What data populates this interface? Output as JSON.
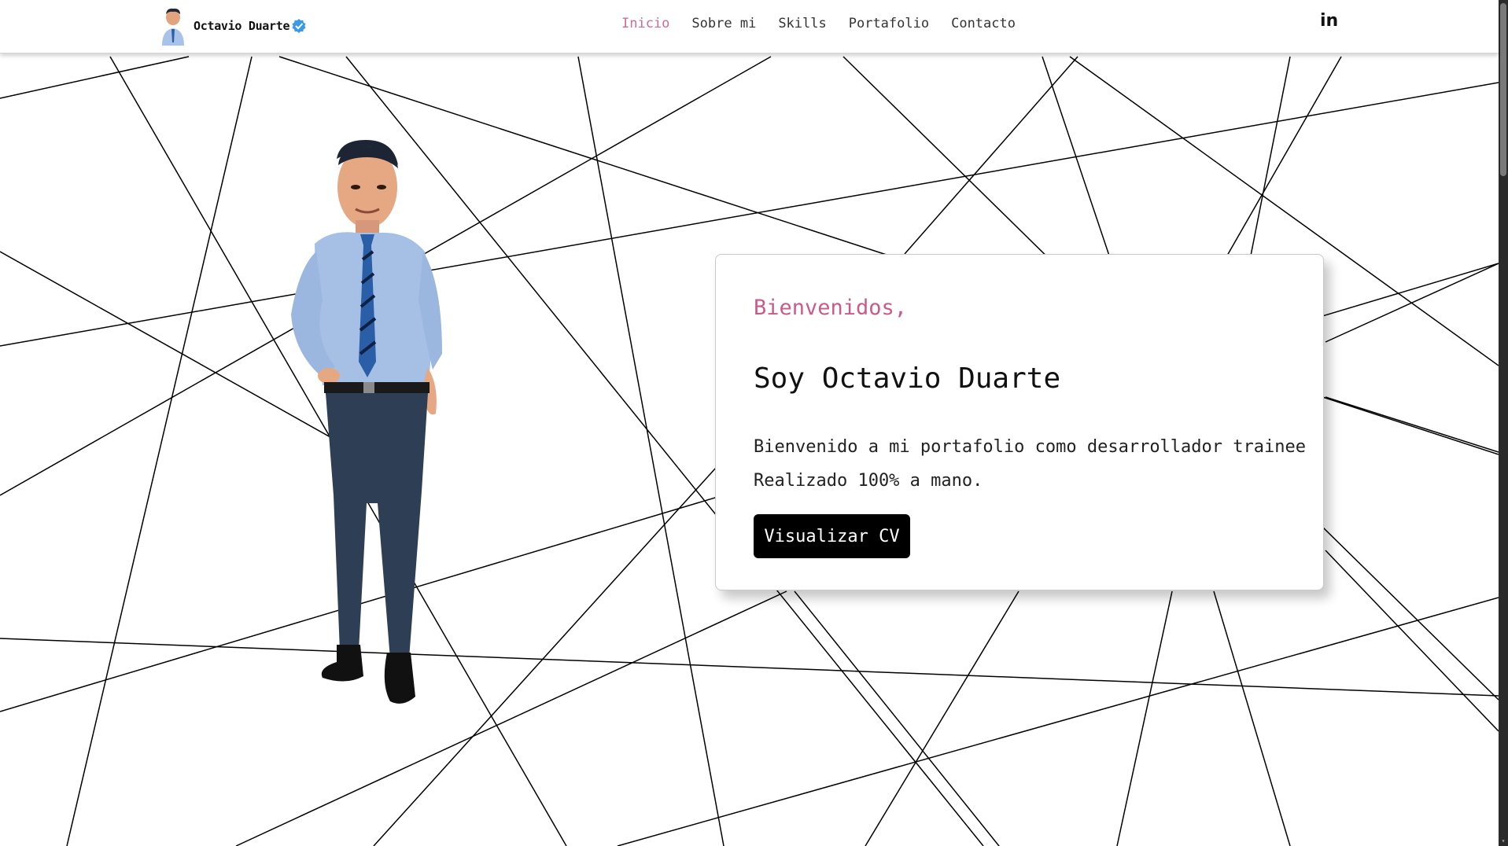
{
  "header": {
    "brand_name": "Octavio Duarte",
    "nav": [
      {
        "label": "Inicio",
        "active": true
      },
      {
        "label": "Sobre mi",
        "active": false
      },
      {
        "label": "Skills",
        "active": false
      },
      {
        "label": "Portafolio",
        "active": false
      },
      {
        "label": "Contacto",
        "active": false
      }
    ],
    "social_icon": "linkedin-icon",
    "social_label": "in"
  },
  "hero": {
    "greeting": "Bienvenidos,",
    "title": "Soy Octavio Duarte",
    "description_line1": "Bienvenido a mi portafolio como desarrollador trainee",
    "description_line2": "Realizado 100% a mano.",
    "cv_button": "Visualizar CV"
  },
  "colors": {
    "accent": "#c95b8c",
    "nav_active": "#d06a95",
    "button_bg": "#000000",
    "verified": "#3b9ae8"
  }
}
